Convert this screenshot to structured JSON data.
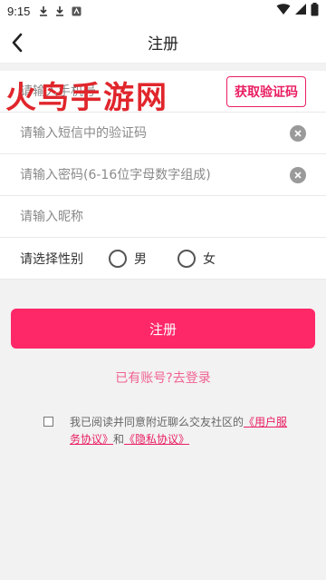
{
  "status": {
    "time": "9:15"
  },
  "header": {
    "title": "注册"
  },
  "watermark": "火鸟手游网",
  "form": {
    "phone_placeholder": "请输入手机号",
    "get_code_label": "获取验证码",
    "sms_code_placeholder": "请输入短信中的验证码",
    "password_placeholder": "请输入密码(6-16位字母数字组成)",
    "nickname_placeholder": "请输入昵称",
    "gender_label": "请选择性别",
    "gender_male": "男",
    "gender_female": "女"
  },
  "register_button": "注册",
  "login_link": "已有账号?去登录",
  "agreement": {
    "prefix": "我已阅读并同意附近聊么交友社区的",
    "user_agreement": "《用户服务协议》",
    "conjunction": "和",
    "privacy_agreement": "《隐私协议》"
  },
  "colors": {
    "accent": "#fe2768",
    "link": "#e91e63"
  }
}
